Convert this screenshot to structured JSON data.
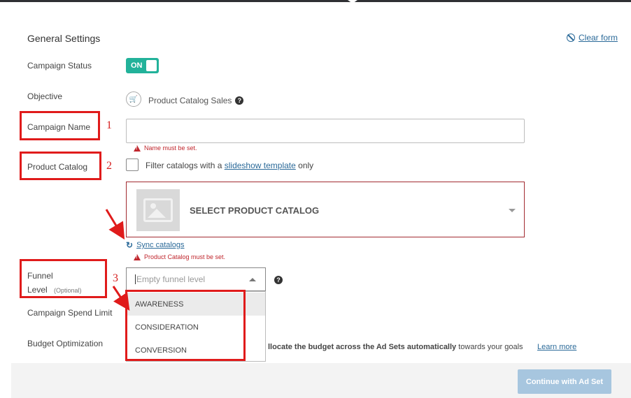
{
  "header": {
    "section_title": "General Settings",
    "clear_form_label": "Clear form"
  },
  "fields": {
    "campaign_status": {
      "label": "Campaign Status",
      "toggle_label": "ON"
    },
    "objective": {
      "label": "Objective",
      "value": "Product Catalog Sales"
    },
    "campaign_name": {
      "label": "Campaign Name",
      "value": "",
      "error": "Name must be set."
    },
    "product_catalog": {
      "label": "Product Catalog",
      "filter_prefix": "Filter catalogs with a",
      "filter_link": "slideshow template",
      "filter_suffix": "only",
      "select_label": "SELECT PRODUCT CATALOG",
      "sync_label": "Sync catalogs",
      "error": "Product Catalog must be set."
    },
    "funnel_level": {
      "label_line1": "Funnel",
      "label_line2": "Level",
      "optional": "(Optional)",
      "placeholder": "Empty funnel level",
      "options": [
        "AWARENESS",
        "CONSIDERATION",
        "CONVERSION"
      ],
      "highlighted": "AWARENESS"
    },
    "campaign_spend_limit": {
      "label": "Campaign Spend Limit"
    },
    "budget_optimization": {
      "label": "Budget Optimization",
      "text_bold": "llocate the budget across the Ad Sets automatically",
      "text_rest": "towards your goals",
      "learn_more": "Learn more"
    }
  },
  "footer": {
    "continue_label": "Continue with Ad Set"
  },
  "annotations": {
    "n1": "1",
    "n2": "2",
    "n3": "3"
  },
  "colors": {
    "accent": "#22b29a",
    "link": "#2b6a99",
    "error": "#c0262d",
    "annotation": "#e01b1b",
    "button_disabled": "#a7c6df"
  },
  "icons": {
    "clear_form": "ban-icon",
    "objective": "cart-icon",
    "help": "question-circle-icon",
    "warning": "warning-icon",
    "sync": "refresh-icon",
    "catalog": "image-placeholder-icon"
  }
}
